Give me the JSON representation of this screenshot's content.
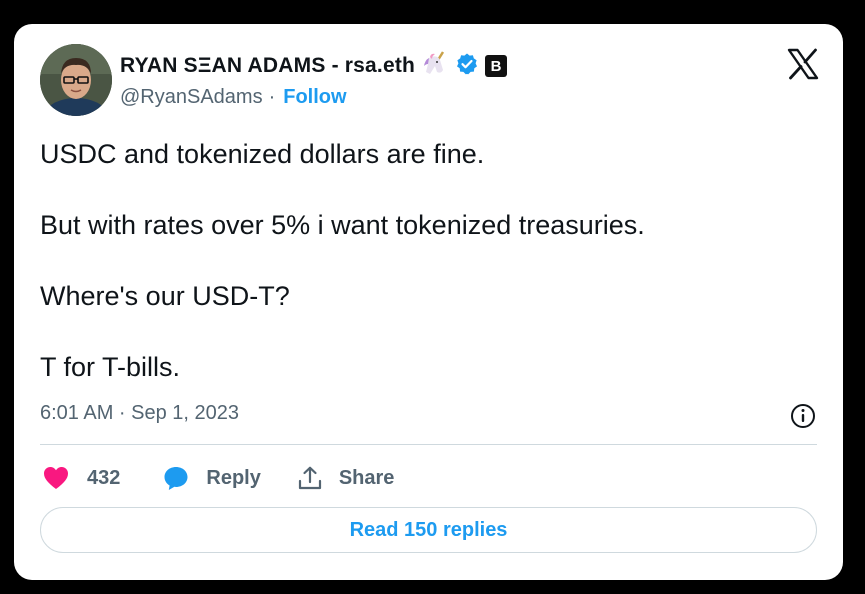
{
  "author": {
    "name": "RYAN SΞAN ADAMS - rsa.eth",
    "handle": "@RyanSAdams",
    "separator": "·",
    "follow_label": "Follow",
    "badge_letter": "B"
  },
  "tweet": {
    "paragraphs": [
      "USDC and tokenized dollars are fine.",
      "But with rates over 5% i want tokenized treasuries.",
      "Where's our USD-T?",
      "T for T-bills."
    ],
    "timestamp": "6:01 AM · Sep 1, 2023"
  },
  "actions": {
    "like_count": "432",
    "reply_label": "Reply",
    "share_label": "Share"
  },
  "read_replies_label": "Read 150 replies",
  "colors": {
    "accent": "#1d9bf0",
    "like": "#f91880",
    "text": "#0f1419",
    "muted": "#536471"
  },
  "icons": [
    "x-logo-icon",
    "verified-badge-icon",
    "unicorn-icon",
    "heart-icon",
    "reply-icon",
    "share-icon",
    "info-icon"
  ]
}
